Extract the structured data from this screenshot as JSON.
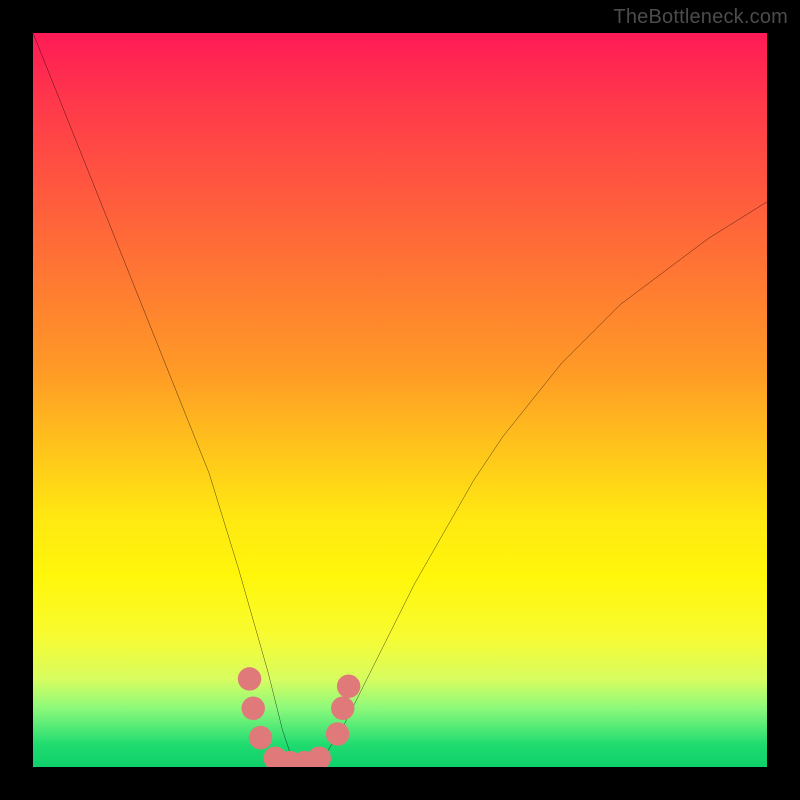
{
  "watermark": "TheBottleneck.com",
  "chart_data": {
    "type": "line",
    "title": "",
    "xlabel": "",
    "ylabel": "",
    "xlim": [
      0,
      100
    ],
    "ylim": [
      0,
      100
    ],
    "grid": false,
    "legend": false,
    "series": [
      {
        "name": "curve",
        "color": "#000000",
        "x": [
          0,
          4,
          8,
          12,
          16,
          20,
          24,
          28,
          30,
          32,
          33,
          34,
          35,
          36,
          38,
          40,
          42,
          44,
          48,
          52,
          56,
          60,
          64,
          68,
          72,
          76,
          80,
          84,
          88,
          92,
          96,
          100
        ],
        "y": [
          100,
          90,
          80,
          70,
          60,
          50,
          40,
          27,
          20,
          13,
          9,
          5,
          2,
          0.5,
          0.5,
          2,
          5,
          9,
          17,
          25,
          32,
          39,
          45,
          50,
          55,
          59,
          63,
          66,
          69,
          72,
          74.5,
          77
        ]
      }
    ],
    "markers": {
      "color": "#e07a7a",
      "radius": 1.6,
      "points": [
        {
          "x": 29.5,
          "y": 12
        },
        {
          "x": 30,
          "y": 8
        },
        {
          "x": 31,
          "y": 4
        },
        {
          "x": 33,
          "y": 1.2
        },
        {
          "x": 35,
          "y": 0.6
        },
        {
          "x": 37,
          "y": 0.6
        },
        {
          "x": 39,
          "y": 1.2
        },
        {
          "x": 41.5,
          "y": 4.5
        },
        {
          "x": 42.2,
          "y": 8
        },
        {
          "x": 43,
          "y": 11
        }
      ]
    }
  }
}
